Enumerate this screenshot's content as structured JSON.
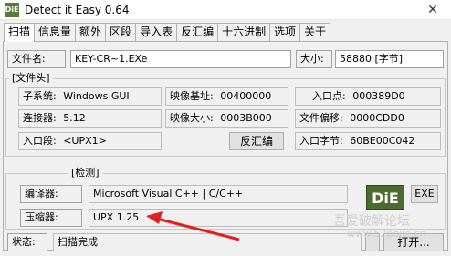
{
  "window": {
    "title": "Detect it Easy 0.64",
    "icon_text": "DiE",
    "close_glyph": "✕"
  },
  "tabs": [
    "扫描",
    "信息量",
    "额外",
    "区段",
    "导入表",
    "反汇编",
    "十六进制",
    "选项",
    "关于"
  ],
  "file": {
    "name_label": "文件名:",
    "name_value": "KEY-CR~1.EXe",
    "size_label": "大小:",
    "size_value": "58880 [字节]"
  },
  "header_group": {
    "title": "[文件头]",
    "subsystem_label": "子系统:",
    "subsystem_value": "Windows GUI",
    "linker_label": "连接器:",
    "linker_value": "5.12",
    "entry_section_label": "入口段:",
    "entry_section_value": "<UPX1>",
    "image_base_label": "映像基址:",
    "image_base_value": "00400000",
    "image_size_label": "映像大小:",
    "image_size_value": "0003B000",
    "disasm_button": "反汇编",
    "entry_point_label": "入口点:",
    "entry_point_value": "000389D0",
    "file_offset_label": "文件偏移:",
    "file_offset_value": "0000CDD0",
    "entry_bytes_label": "入口字节:",
    "entry_bytes_value": "60BE00C042"
  },
  "detect_group": {
    "title": "[检测]",
    "compiler_label": "编译器:",
    "compiler_value": "Microsoft Visual C++ | C/C++",
    "packer_label": "压缩器:",
    "packer_value": "UPX 1.25",
    "logo_text": "DiE",
    "exe_button": "EXE"
  },
  "status": {
    "label": "状态:",
    "value": "扫描完成",
    "open_button": "打开..."
  },
  "watermark": {
    "line1": "吾爱破解论坛",
    "line2": "www.52pojie.cn"
  },
  "colors": {
    "panel_bg": "#f0f0f0",
    "arrow": "#e02020",
    "logo_bg": "#4b6b2f"
  }
}
